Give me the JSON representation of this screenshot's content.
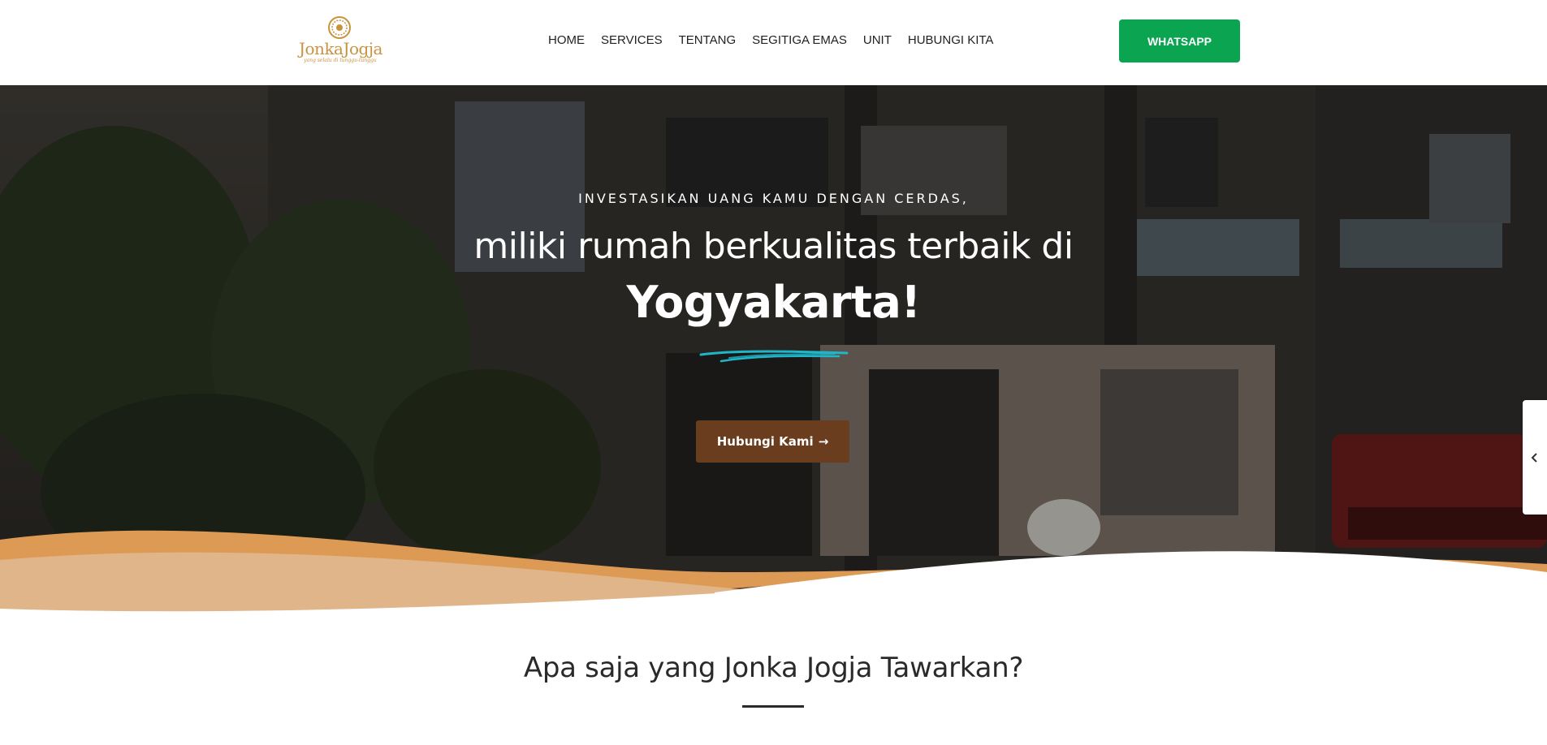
{
  "header": {
    "logo": {
      "name": "JonkaJogja",
      "tagline": "yang selalu di tunggu-tunggu"
    },
    "nav": [
      {
        "label": "HOME"
      },
      {
        "label": "SERVICES"
      },
      {
        "label": "TENTANG"
      },
      {
        "label": "SEGITIGA EMAS"
      },
      {
        "label": "UNIT"
      },
      {
        "label": "HUBUNGI KITA"
      }
    ],
    "whatsapp_label": "WHATSAPP"
  },
  "hero": {
    "subtitle": "INVESTASIKAN UANG KAMU DENGAN CERDAS,",
    "title_line1": "miliki rumah berkualitas terbaik di",
    "title_line2": "Yogyakarta!",
    "cta_label": "Hubungi Kami",
    "cta_icon": "arrow-right-icon",
    "side_tab_icon": "chevron-left-icon"
  },
  "section": {
    "title": "Apa saja yang Jonka Jogja Tawarkan?"
  },
  "colors": {
    "whatsapp": "#0ba552",
    "cta": "#6b3d1f",
    "wave_light": "#e0b58a",
    "wave_orange": "#dd9a55",
    "wave_brown": "#6b3d1f",
    "accent_scribble": "#1fb6c9",
    "logo_gold": "#c9923f"
  }
}
